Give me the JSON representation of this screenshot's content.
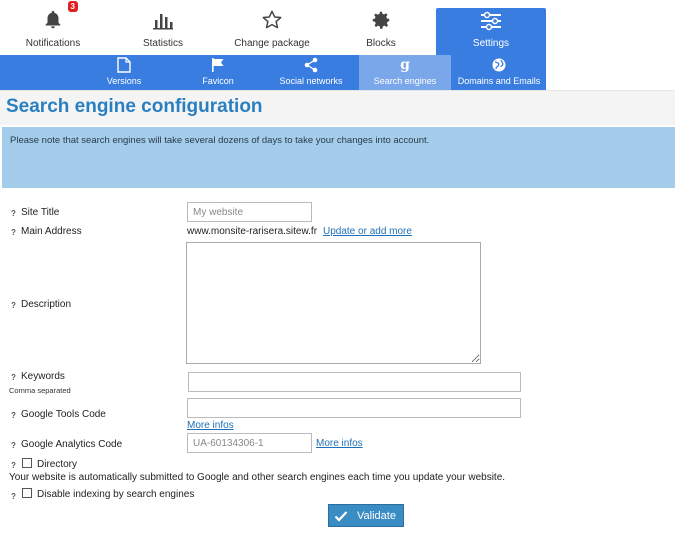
{
  "tabs": [
    {
      "label": "Notifications",
      "icon": "bell-icon",
      "badge": "3"
    },
    {
      "label": "Statistics",
      "icon": "bar-chart-icon"
    },
    {
      "label": "Change package",
      "icon": "star-icon"
    },
    {
      "label": "Blocks",
      "icon": "gear-icon"
    },
    {
      "label": "Settings",
      "icon": "sliders-icon",
      "active": true
    }
  ],
  "subtabs": [
    {
      "label": "Versions",
      "icon": "document-icon"
    },
    {
      "label": "Favicon",
      "icon": "flag-icon"
    },
    {
      "label": "Social networks",
      "icon": "share-icon"
    },
    {
      "label": "Search engines",
      "icon": "google-icon",
      "active": true
    },
    {
      "label": "Domains and Emails",
      "icon": "globe-icon"
    }
  ],
  "page": {
    "title": "Search engine configuration",
    "notice": "Please note that search engines will take several dozens of days to take your changes into account."
  },
  "form": {
    "help_mark": "?",
    "site_title": {
      "label": "Site Title",
      "value": "",
      "placeholder": "My website"
    },
    "main_address": {
      "label": "Main Address",
      "value": "www.monsite-rarisera.sitew.fr",
      "link": "Update or add more"
    },
    "description": {
      "label": "Description",
      "value": ""
    },
    "keywords": {
      "label": "Keywords",
      "sublabel": "Comma separated",
      "value": ""
    },
    "google_tools": {
      "label": "Google Tools Code",
      "value": "",
      "link": "More infos"
    },
    "google_analytics": {
      "label": "Google Analytics Code",
      "value": "",
      "placeholder": "UA-60134306-1",
      "link": "More infos"
    },
    "directory": {
      "label": "Directory",
      "checked": false,
      "hint": "Your website is automatically submitted to Google and other search engines each time you update your website."
    },
    "disable_indexing": {
      "label": "Disable indexing by search engines",
      "checked": false
    },
    "validate_label": "Validate"
  },
  "colors": {
    "accent": "#3a7de0",
    "title": "#2a7fc0",
    "notice_bg": "#a3cdea",
    "button": "#3a8cc4"
  }
}
